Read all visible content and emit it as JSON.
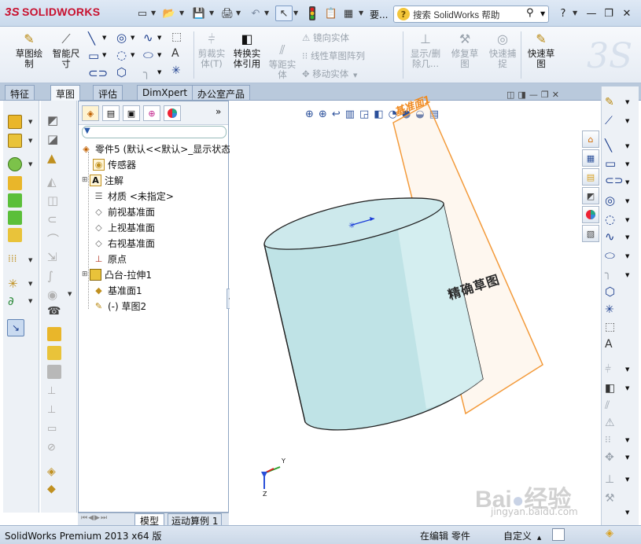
{
  "app": {
    "logo_prefix": "3S",
    "logo_text": "SOLIDWORKS",
    "search_placeholder": "搜索 SolidWorks 帮助",
    "more_label": "要..."
  },
  "command_manager": {
    "sketch_draw_label": "草图绘\n制",
    "smart_dim_label": "智能尺\n寸",
    "trim_label": "剪裁实\n体(T)",
    "convert_label": "转换实\n体引用",
    "offset_label": "等距实\n体",
    "mirror_label": "镜向实体",
    "linear_pattern_label": "线性草图阵列",
    "move_label": "移动实体",
    "show_delete_label": "显示/删\n除几...",
    "repair_label": "修复草\n图",
    "quick_snap_label": "快速捕\n捉",
    "rapid_sketch_label": "快速草\n图"
  },
  "tabs": [
    {
      "label": "特征"
    },
    {
      "label": "草图"
    },
    {
      "label": "评估"
    },
    {
      "label": "DimXpert"
    },
    {
      "label": "办公室产品"
    }
  ],
  "feature_tree": {
    "root": "零件5 (默认<<默认>_显示状态",
    "items": [
      {
        "label": "传感器"
      },
      {
        "label": "注解"
      },
      {
        "label": "材质 <未指定>"
      },
      {
        "label": "前视基准面"
      },
      {
        "label": "上视基准面"
      },
      {
        "label": "右视基准面"
      },
      {
        "label": "原点"
      },
      {
        "label": "凸台-拉伸1"
      },
      {
        "label": "基准面1"
      },
      {
        "label": "(-) 草图2"
      }
    ]
  },
  "fm_bottom_tabs": [
    {
      "label": "模型"
    },
    {
      "label": "运动算例 1"
    }
  ],
  "viewport": {
    "plane_label": "基准面1",
    "sketch_text": "精确草图",
    "triad_y": "Y",
    "triad_z": "Z",
    "cylinder_color": "#bfe3e6",
    "plane_color": "#f39a3a"
  },
  "status_bar": {
    "version": "SolidWorks Premium 2013 x64 版",
    "editing": "在编辑 零件",
    "custom": "自定义"
  },
  "watermark": {
    "line1": "Bai",
    "line2": "经验",
    "url": "jingyan.baidu.com"
  }
}
